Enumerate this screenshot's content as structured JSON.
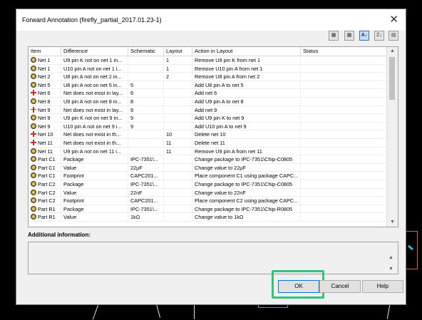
{
  "window": {
    "title": "Forward Annotation (firefly_partial_2017.01.23-1)",
    "close_glyph": "✕"
  },
  "toolbar": [
    {
      "name": "toolbar-button-1",
      "icon": "filter-icon",
      "glyph": "▦"
    },
    {
      "name": "toolbar-button-2",
      "icon": "filter-icon",
      "glyph": "▦"
    },
    {
      "name": "toolbar-button-sort-az",
      "icon": "sort-az-icon",
      "glyph": "A↓"
    },
    {
      "name": "toolbar-button-sort-za",
      "icon": "sort-za-icon",
      "glyph": "Z↓"
    },
    {
      "name": "toolbar-button-print",
      "icon": "print-icon",
      "glyph": "▤"
    }
  ],
  "table": {
    "columns": [
      "Item",
      "Difference",
      "Schematic",
      "Layout",
      "Action in Layout",
      "Status"
    ],
    "rows": [
      {
        "icon": "gear",
        "item": "Net 1",
        "difference": "U9 pin K not on net 1 in...",
        "schematic": "",
        "layout": "1",
        "action": "Remove U9 pin K from net 1",
        "status": ""
      },
      {
        "icon": "gear",
        "item": "Net 1",
        "difference": "U10 pin A not on net 1 i...",
        "schematic": "",
        "layout": "1",
        "action": "Remove U10 pin A from net 1",
        "status": ""
      },
      {
        "icon": "gear",
        "item": "Net 2",
        "difference": "U8 pin A not on net 2 in...",
        "schematic": "",
        "layout": "2",
        "action": "Remove U8 pin A from net 2",
        "status": ""
      },
      {
        "icon": "gear",
        "item": "Net 5",
        "difference": "U8 pin A not on net 5 in...",
        "schematic": "5",
        "layout": "",
        "action": "Add U8 pin A to net 5",
        "status": ""
      },
      {
        "icon": "add",
        "item": "Net 6",
        "difference": "Net does not exist in lay...",
        "schematic": "6",
        "layout": "",
        "action": "Add net 6",
        "status": ""
      },
      {
        "icon": "gear",
        "item": "Net 8",
        "difference": "U9 pin A not on net 8 in...",
        "schematic": "8",
        "layout": "",
        "action": "Add U9 pin A to net 8",
        "status": ""
      },
      {
        "icon": "add",
        "item": "Net 9",
        "difference": "Net does not exist in lay...",
        "schematic": "9",
        "layout": "",
        "action": "Add net 9",
        "status": ""
      },
      {
        "icon": "gear",
        "item": "Net 9",
        "difference": "U9 pin K not on net 9 in...",
        "schematic": "9",
        "layout": "",
        "action": "Add U9 pin K to net 9",
        "status": ""
      },
      {
        "icon": "gear",
        "item": "Net 9",
        "difference": "U10 pin A not on net 9 i...",
        "schematic": "9",
        "layout": "",
        "action": "Add U10 pin A to net 9",
        "status": ""
      },
      {
        "icon": "add",
        "item": "Net 10",
        "difference": "Net does not exist in th...",
        "schematic": "",
        "layout": "10",
        "action": "Delete net 10",
        "status": ""
      },
      {
        "icon": "add",
        "item": "Net 11",
        "difference": "Net does not exist in th...",
        "schematic": "",
        "layout": "11",
        "action": "Delete net 11",
        "status": ""
      },
      {
        "icon": "gear",
        "item": "Net 11",
        "difference": "U9 pin A not on net 11 i...",
        "schematic": "",
        "layout": "11",
        "action": "Remove U9 pin A from net 11",
        "status": ""
      },
      {
        "icon": "gear",
        "item": "Part C1",
        "difference": "Package",
        "schematic": "IPC-7351\\...",
        "layout": "",
        "action": "Change package to IPC-7351\\Chip-C0805",
        "status": ""
      },
      {
        "icon": "gear",
        "item": "Part C1",
        "difference": "Value",
        "schematic": "22µF",
        "layout": "",
        "action": "Change value to 22µF",
        "status": ""
      },
      {
        "icon": "gear",
        "item": "Part C1",
        "difference": "Footprint",
        "schematic": "CAPC201...",
        "layout": "",
        "action": "Place component C1 using package CAPC...",
        "status": ""
      },
      {
        "icon": "gear",
        "item": "Part C2",
        "difference": "Package",
        "schematic": "IPC-7351\\...",
        "layout": "",
        "action": "Change package to IPC-7351\\Chip-C0805",
        "status": ""
      },
      {
        "icon": "gear",
        "item": "Part C2",
        "difference": "Value",
        "schematic": "22nF",
        "layout": "",
        "action": "Change value to 22nF",
        "status": ""
      },
      {
        "icon": "gear",
        "item": "Part C2",
        "difference": "Footprint",
        "schematic": "CAPC201...",
        "layout": "",
        "action": "Place component C2 using package CAPC...",
        "status": ""
      },
      {
        "icon": "gear",
        "item": "Part R1",
        "difference": "Package",
        "schematic": "IPC-7351\\...",
        "layout": "",
        "action": "Change package to IPC-7351\\Chip-R0805",
        "status": ""
      },
      {
        "icon": "gear",
        "item": "Part R1",
        "difference": "Value",
        "schematic": "1kΩ",
        "layout": "",
        "action": "Change value to 1kΩ",
        "status": ""
      }
    ]
  },
  "additional_info": {
    "label": "Additional information:",
    "text": ""
  },
  "buttons": {
    "ok": "OK",
    "cancel": "Cancel",
    "help": "Help"
  },
  "scroll_arrows": {
    "up": "▲",
    "down": "▼"
  }
}
